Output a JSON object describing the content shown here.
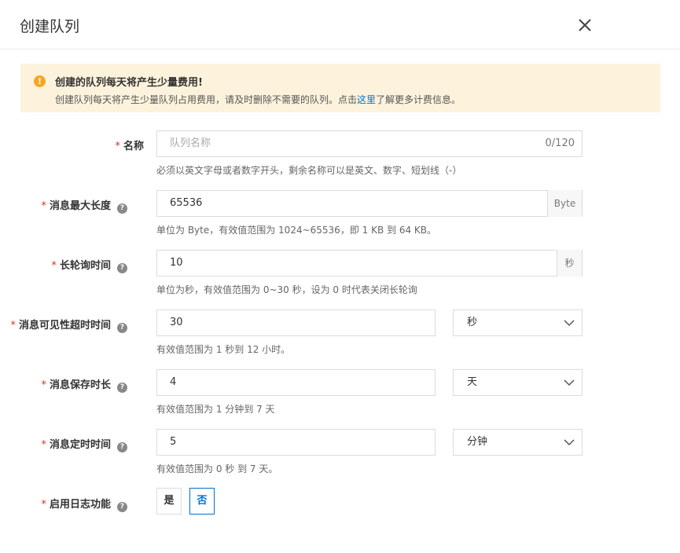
{
  "dialog": {
    "title": "创建队列"
  },
  "notice": {
    "title": "创建的队列每天将产生少量费用!",
    "text_before": "创建队列每天将产生少量队列占用费用，请及时删除不需要的队列。点击",
    "link": "这里",
    "text_after": "了解更多计费信息。",
    "icon": "warning-icon",
    "color": "#fdf3dc"
  },
  "fields": {
    "name": {
      "label": "名称",
      "placeholder": "队列名称",
      "counter": "0/120",
      "hint": "必须以英文字母或者数字开头，剩余名称可以是英文、数字、短划线（-）"
    },
    "max_length": {
      "label": "消息最大长度",
      "value": "65536",
      "unit": "Byte",
      "hint": "单位为 Byte，有效值范围为 1024~65536，即 1 KB 到 64 KB。"
    },
    "long_poll": {
      "label": "长轮询时间",
      "value": "10",
      "unit": "秒",
      "hint": "单位为秒，有效值范围为 0~30 秒，设为 0 时代表关闭长轮询"
    },
    "visibility": {
      "label": "消息可见性超时时间",
      "value": "30",
      "unit": "秒",
      "hint": "有效值范围为 1 秒到 12 小时。"
    },
    "retention": {
      "label": "消息保存时长",
      "value": "4",
      "unit": "天",
      "hint": "有效值范围为 1 分钟到 7 天"
    },
    "delay": {
      "label": "消息定时时间",
      "value": "5",
      "unit": "分钟",
      "hint": "有效值范围为 0 秒 到 7 天。"
    },
    "logging": {
      "label": "启用日志功能",
      "yes": "是",
      "no": "否",
      "selected": "否"
    }
  },
  "colors": {
    "required": "#d93026",
    "link": "#0070cc",
    "selected": "#0070cc"
  }
}
